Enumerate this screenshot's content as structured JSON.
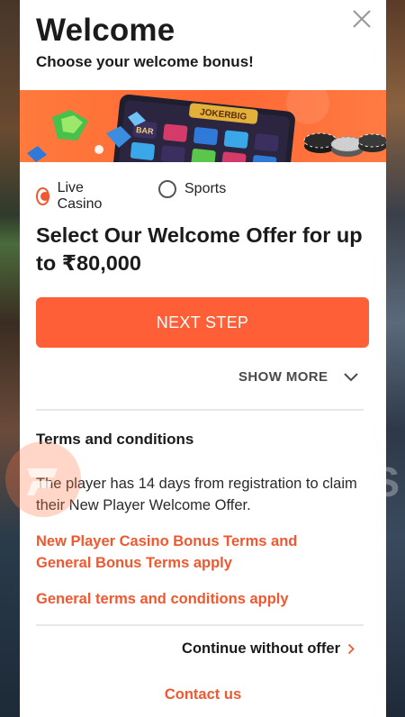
{
  "modal": {
    "title": "Welcome",
    "subtitle": "Choose your welcome bonus!",
    "banner": {
      "slot_sign_text": "JOKERBIG",
      "symbol_text": "BAR"
    },
    "bonus_options": [
      {
        "label": "Live Casino",
        "selected": true
      },
      {
        "label": "Sports",
        "selected": false
      }
    ],
    "offer_heading": "Select Our Welcome Offer for up to ₹80,000",
    "next_button_label": "NEXT STEP",
    "show_more_label": "SHOW MORE",
    "terms": {
      "heading": "Terms and conditions",
      "text": "The player has 14 days from registration to claim their New Player Welcome Offer.",
      "bonus_terms_link": "New Player Casino Bonus Terms and General Bonus Terms apply",
      "general_terms_link": "General terms and conditions apply"
    },
    "continue_label": "Continue without offer",
    "contact_label": "Contact us"
  },
  "background": {
    "watermark_text": "S"
  },
  "colors": {
    "accent": "#ff5f36",
    "link": "#f0582f",
    "banner": "#ff6733",
    "text": "#1b1b1b"
  },
  "icons": {
    "close": "close-icon",
    "show_more": "chevron-down-icon",
    "continue": "chevron-right-icon",
    "brand": "brand-logo-icon"
  }
}
